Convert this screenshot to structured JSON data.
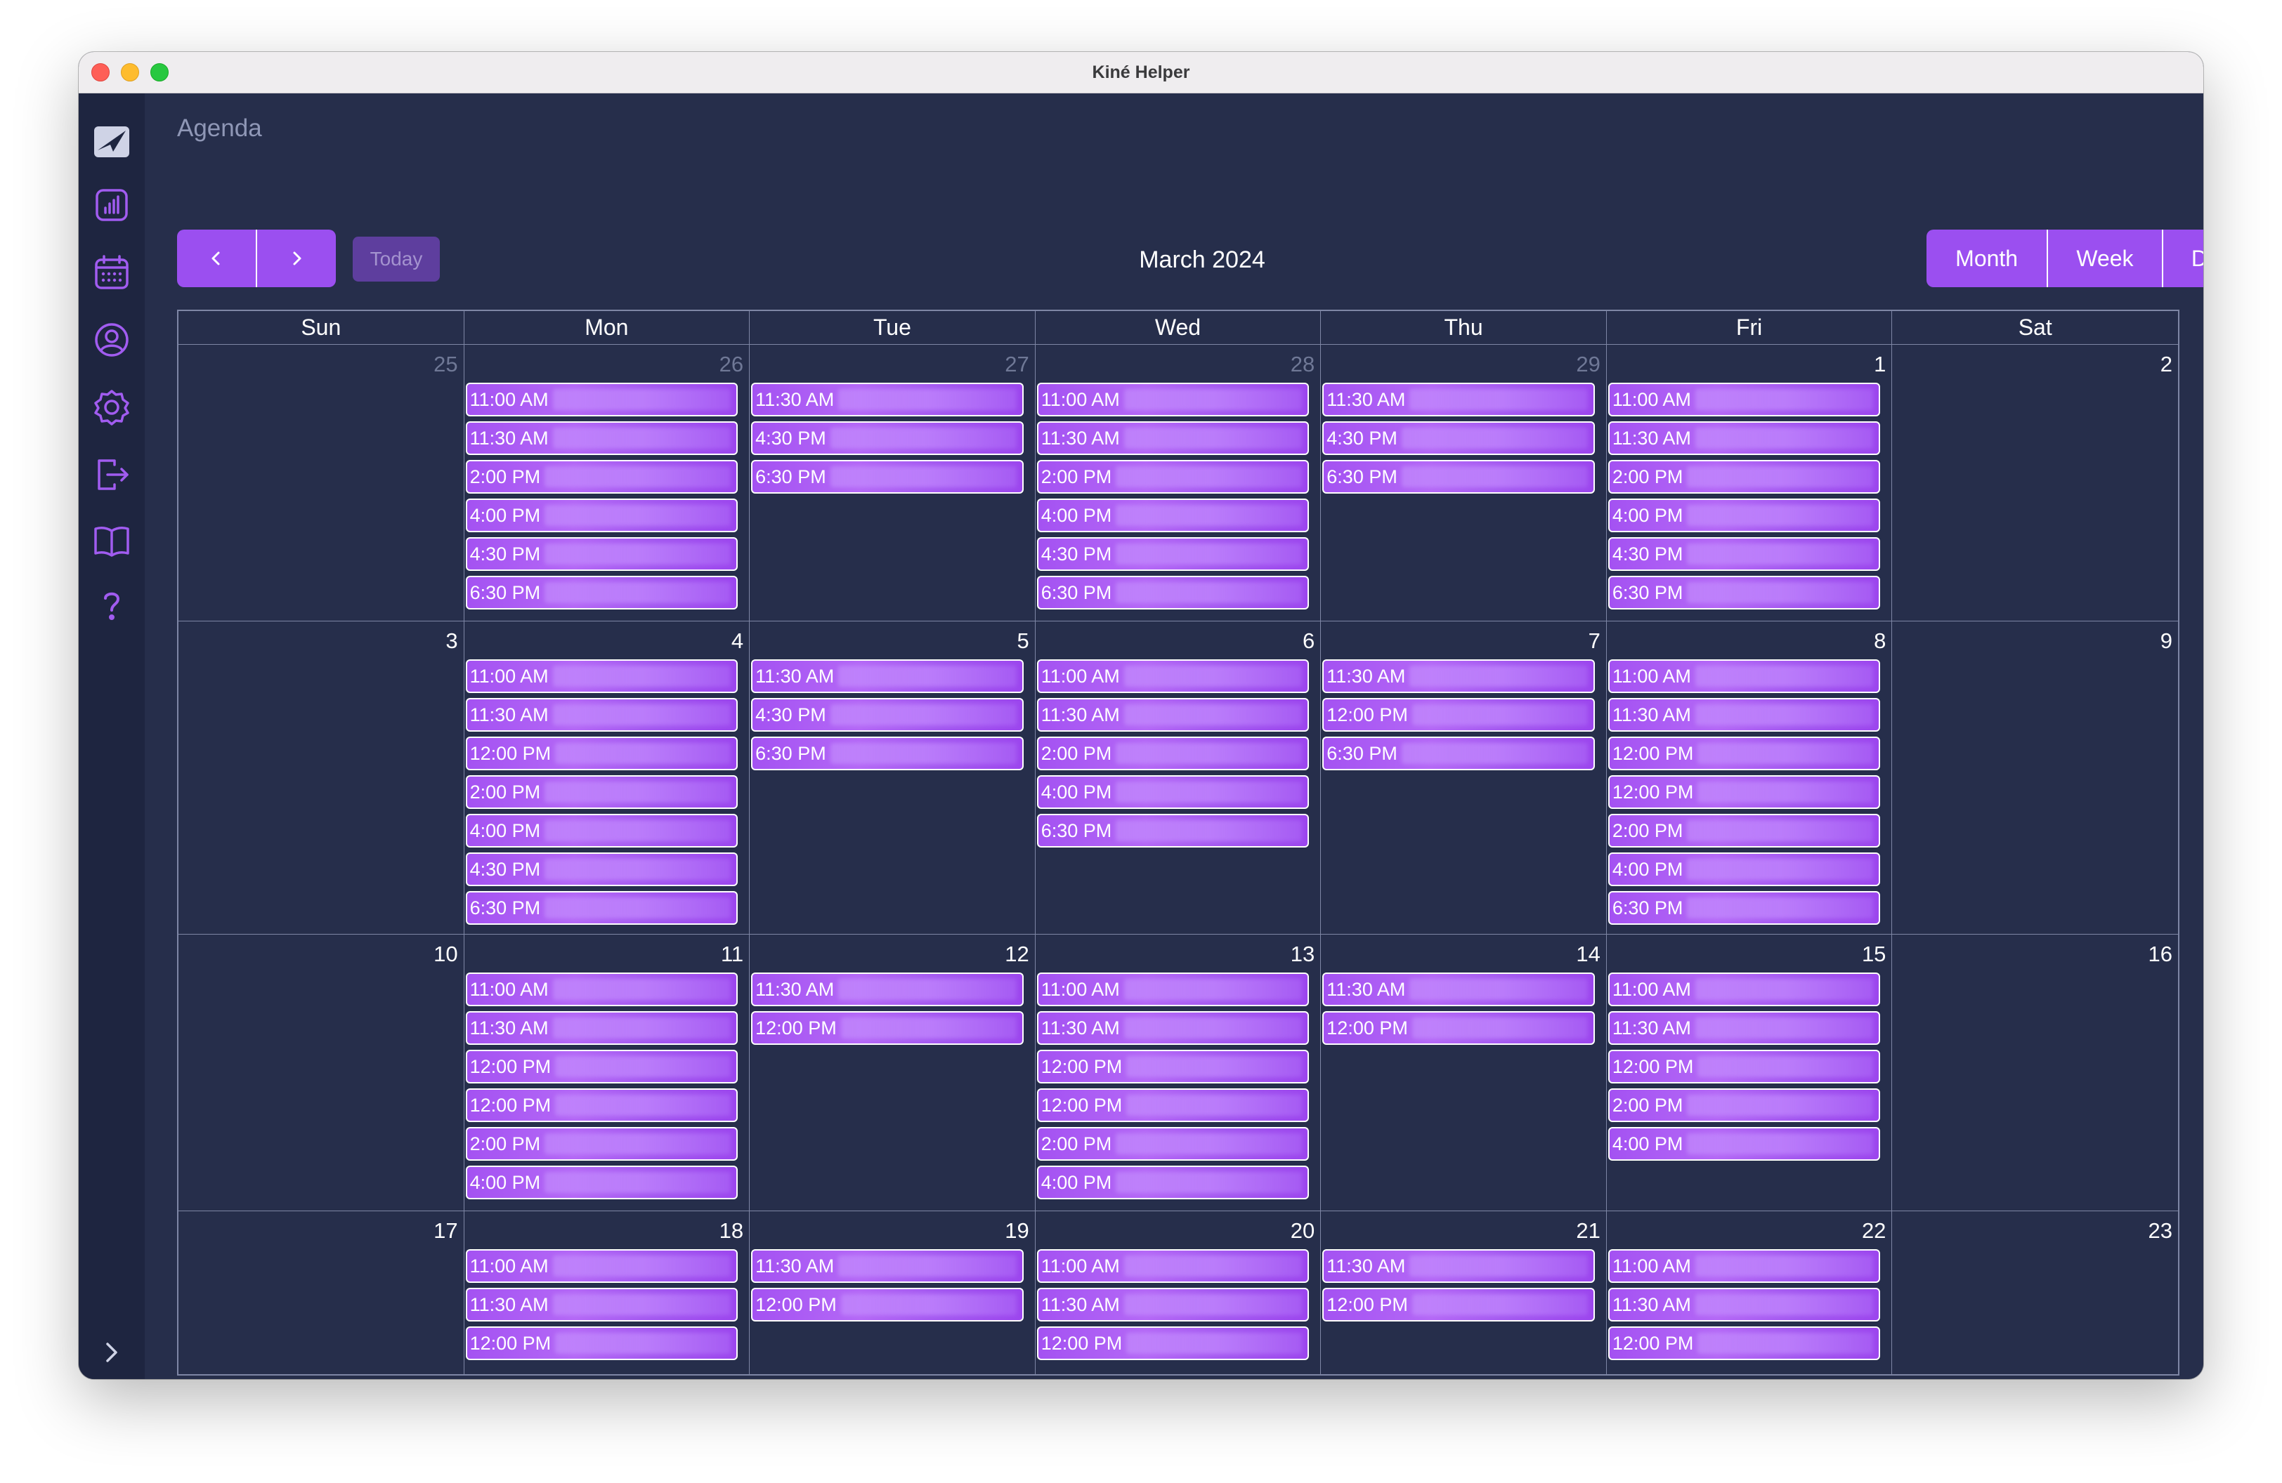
{
  "window": {
    "title": "Kiné Helper"
  },
  "sidebar": {
    "items": [
      {
        "icon": "app-logo-icon"
      },
      {
        "icon": "statistics-icon"
      },
      {
        "icon": "calendar-icon"
      },
      {
        "icon": "patient-icon"
      },
      {
        "icon": "settings-icon"
      },
      {
        "icon": "logout-icon"
      },
      {
        "icon": "documentation-icon"
      },
      {
        "icon": "help-icon"
      }
    ],
    "expand_icon": "chevron-right-icon"
  },
  "header": {
    "title": "Agenda",
    "prev_label": "‹",
    "next_label": "›",
    "today_label": "Today",
    "month_label": "March 2024",
    "views": [
      "Month",
      "Week",
      "Day"
    ],
    "active_view": "Month"
  },
  "calendar": {
    "weekdays": [
      "Sun",
      "Mon",
      "Tue",
      "Wed",
      "Thu",
      "Fri",
      "Sat"
    ],
    "weeks": [
      [
        {
          "day": "25",
          "muted": true,
          "events": []
        },
        {
          "day": "26",
          "muted": true,
          "events": [
            "11:00 AM",
            "11:30 AM",
            "2:00 PM",
            "4:00 PM",
            "4:30 PM",
            "6:30 PM"
          ]
        },
        {
          "day": "27",
          "muted": true,
          "events": [
            "11:30 AM",
            "4:30 PM",
            "6:30 PM"
          ]
        },
        {
          "day": "28",
          "muted": true,
          "events": [
            "11:00 AM",
            "11:30 AM",
            "2:00 PM",
            "4:00 PM",
            "4:30 PM",
            "6:30 PM"
          ]
        },
        {
          "day": "29",
          "muted": true,
          "events": [
            "11:30 AM",
            "4:30 PM",
            "6:30 PM"
          ]
        },
        {
          "day": "1",
          "muted": false,
          "events": [
            "11:00 AM",
            "11:30 AM",
            "2:00 PM",
            "4:00 PM",
            "4:30 PM",
            "6:30 PM"
          ]
        },
        {
          "day": "2",
          "muted": false,
          "events": []
        }
      ],
      [
        {
          "day": "3",
          "muted": false,
          "events": []
        },
        {
          "day": "4",
          "muted": false,
          "events": [
            "11:00 AM",
            "11:30 AM",
            "12:00 PM",
            "2:00 PM",
            "4:00 PM",
            "4:30 PM",
            "6:30 PM"
          ]
        },
        {
          "day": "5",
          "muted": false,
          "events": [
            "11:30 AM",
            "4:30 PM",
            "6:30 PM"
          ]
        },
        {
          "day": "6",
          "muted": false,
          "events": [
            "11:00 AM",
            "11:30 AM",
            "2:00 PM",
            "4:00 PM",
            "6:30 PM"
          ]
        },
        {
          "day": "7",
          "muted": false,
          "events": [
            "11:30 AM",
            "12:00 PM",
            "6:30 PM"
          ]
        },
        {
          "day": "8",
          "muted": false,
          "events": [
            "11:00 AM",
            "11:30 AM",
            "12:00 PM",
            "12:00 PM",
            "2:00 PM",
            "4:00 PM",
            "6:30 PM"
          ]
        },
        {
          "day": "9",
          "muted": false,
          "events": []
        }
      ],
      [
        {
          "day": "10",
          "muted": false,
          "events": []
        },
        {
          "day": "11",
          "muted": false,
          "events": [
            "11:00 AM",
            "11:30 AM",
            "12:00 PM",
            "12:00 PM",
            "2:00 PM",
            "4:00 PM"
          ]
        },
        {
          "day": "12",
          "muted": false,
          "events": [
            "11:30 AM",
            "12:00 PM"
          ]
        },
        {
          "day": "13",
          "muted": false,
          "events": [
            "11:00 AM",
            "11:30 AM",
            "12:00 PM",
            "12:00 PM",
            "2:00 PM",
            "4:00 PM"
          ]
        },
        {
          "day": "14",
          "muted": false,
          "events": [
            "11:30 AM",
            "12:00 PM"
          ]
        },
        {
          "day": "15",
          "muted": false,
          "events": [
            "11:00 AM",
            "11:30 AM",
            "12:00 PM",
            "2:00 PM",
            "4:00 PM"
          ]
        },
        {
          "day": "16",
          "muted": false,
          "events": []
        }
      ],
      [
        {
          "day": "17",
          "muted": false,
          "events": []
        },
        {
          "day": "18",
          "muted": false,
          "events": [
            "11:00 AM",
            "11:30 AM",
            "12:00 PM"
          ]
        },
        {
          "day": "19",
          "muted": false,
          "events": [
            "11:30 AM",
            "12:00 PM"
          ]
        },
        {
          "day": "20",
          "muted": false,
          "events": [
            "11:00 AM",
            "11:30 AM",
            "12:00 PM"
          ]
        },
        {
          "day": "21",
          "muted": false,
          "events": [
            "11:30 AM",
            "12:00 PM"
          ]
        },
        {
          "day": "22",
          "muted": false,
          "events": [
            "11:00 AM",
            "11:30 AM",
            "12:00 PM"
          ]
        },
        {
          "day": "23",
          "muted": false,
          "events": []
        }
      ]
    ]
  },
  "colors": {
    "background": "#262e4b",
    "sidebar": "#1e2540",
    "accent": "#9b4ff0",
    "event": "#a452f2",
    "grid_line": "#7e86a5",
    "muted_text": "#6f7896"
  }
}
